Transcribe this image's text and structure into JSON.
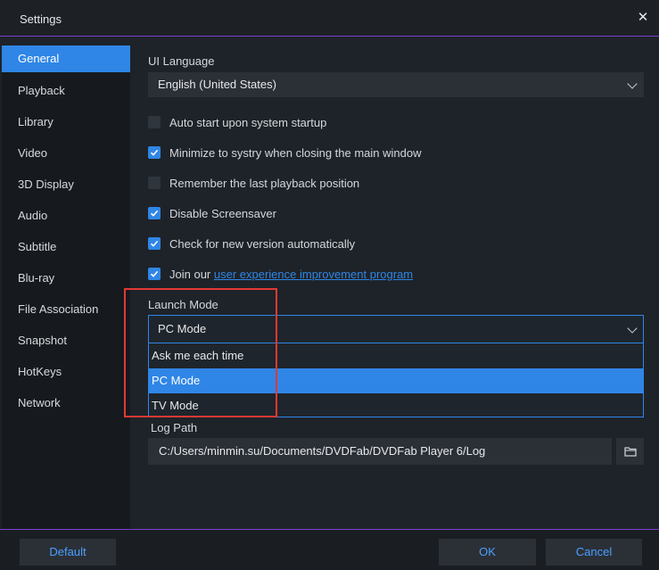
{
  "window": {
    "title": "Settings"
  },
  "sidebar": {
    "items": [
      {
        "label": "General",
        "active": true
      },
      {
        "label": "Playback"
      },
      {
        "label": "Library"
      },
      {
        "label": "Video"
      },
      {
        "label": "3D Display"
      },
      {
        "label": "Audio"
      },
      {
        "label": "Subtitle"
      },
      {
        "label": "Blu-ray"
      },
      {
        "label": "File Association"
      },
      {
        "label": "Snapshot"
      },
      {
        "label": "HotKeys"
      },
      {
        "label": "Network"
      }
    ]
  },
  "general": {
    "ui_language_label": "UI Language",
    "ui_language_value": "English (United States)",
    "options": [
      {
        "label": "Auto start upon system startup",
        "checked": false
      },
      {
        "label": "Minimize to systry when closing the main window",
        "checked": true
      },
      {
        "label": "Remember the last playback position",
        "checked": false
      },
      {
        "label": "Disable Screensaver",
        "checked": true
      },
      {
        "label": "Check for new version automatically",
        "checked": true
      }
    ],
    "join_prefix": "Join our",
    "join_link": "user experience improvement program",
    "join_checked": true,
    "launch_mode_label": "Launch Mode",
    "launch_mode_value": "PC Mode",
    "launch_mode_options": [
      "Ask me each time",
      "PC Mode",
      "TV Mode"
    ],
    "log_path_label": "Log Path",
    "log_path_value": "C:/Users/minmin.su/Documents/DVDFab/DVDFab Player 6/Log"
  },
  "footer": {
    "default_label": "Default",
    "ok_label": "OK",
    "cancel_label": "Cancel"
  },
  "colors": {
    "accent": "#2f86e6",
    "highlight_border": "#e53935",
    "divider": "#7b3fd0"
  }
}
